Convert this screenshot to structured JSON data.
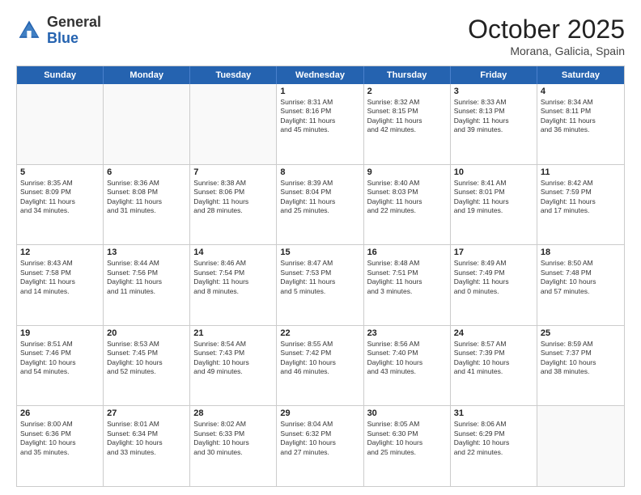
{
  "header": {
    "logo_general": "General",
    "logo_blue": "Blue",
    "month_title": "October 2025",
    "location": "Morana, Galicia, Spain"
  },
  "weekdays": [
    "Sunday",
    "Monday",
    "Tuesday",
    "Wednesday",
    "Thursday",
    "Friday",
    "Saturday"
  ],
  "rows": [
    [
      {
        "day": "",
        "text": ""
      },
      {
        "day": "",
        "text": ""
      },
      {
        "day": "",
        "text": ""
      },
      {
        "day": "1",
        "text": "Sunrise: 8:31 AM\nSunset: 8:16 PM\nDaylight: 11 hours\nand 45 minutes."
      },
      {
        "day": "2",
        "text": "Sunrise: 8:32 AM\nSunset: 8:15 PM\nDaylight: 11 hours\nand 42 minutes."
      },
      {
        "day": "3",
        "text": "Sunrise: 8:33 AM\nSunset: 8:13 PM\nDaylight: 11 hours\nand 39 minutes."
      },
      {
        "day": "4",
        "text": "Sunrise: 8:34 AM\nSunset: 8:11 PM\nDaylight: 11 hours\nand 36 minutes."
      }
    ],
    [
      {
        "day": "5",
        "text": "Sunrise: 8:35 AM\nSunset: 8:09 PM\nDaylight: 11 hours\nand 34 minutes."
      },
      {
        "day": "6",
        "text": "Sunrise: 8:36 AM\nSunset: 8:08 PM\nDaylight: 11 hours\nand 31 minutes."
      },
      {
        "day": "7",
        "text": "Sunrise: 8:38 AM\nSunset: 8:06 PM\nDaylight: 11 hours\nand 28 minutes."
      },
      {
        "day": "8",
        "text": "Sunrise: 8:39 AM\nSunset: 8:04 PM\nDaylight: 11 hours\nand 25 minutes."
      },
      {
        "day": "9",
        "text": "Sunrise: 8:40 AM\nSunset: 8:03 PM\nDaylight: 11 hours\nand 22 minutes."
      },
      {
        "day": "10",
        "text": "Sunrise: 8:41 AM\nSunset: 8:01 PM\nDaylight: 11 hours\nand 19 minutes."
      },
      {
        "day": "11",
        "text": "Sunrise: 8:42 AM\nSunset: 7:59 PM\nDaylight: 11 hours\nand 17 minutes."
      }
    ],
    [
      {
        "day": "12",
        "text": "Sunrise: 8:43 AM\nSunset: 7:58 PM\nDaylight: 11 hours\nand 14 minutes."
      },
      {
        "day": "13",
        "text": "Sunrise: 8:44 AM\nSunset: 7:56 PM\nDaylight: 11 hours\nand 11 minutes."
      },
      {
        "day": "14",
        "text": "Sunrise: 8:46 AM\nSunset: 7:54 PM\nDaylight: 11 hours\nand 8 minutes."
      },
      {
        "day": "15",
        "text": "Sunrise: 8:47 AM\nSunset: 7:53 PM\nDaylight: 11 hours\nand 5 minutes."
      },
      {
        "day": "16",
        "text": "Sunrise: 8:48 AM\nSunset: 7:51 PM\nDaylight: 11 hours\nand 3 minutes."
      },
      {
        "day": "17",
        "text": "Sunrise: 8:49 AM\nSunset: 7:49 PM\nDaylight: 11 hours\nand 0 minutes."
      },
      {
        "day": "18",
        "text": "Sunrise: 8:50 AM\nSunset: 7:48 PM\nDaylight: 10 hours\nand 57 minutes."
      }
    ],
    [
      {
        "day": "19",
        "text": "Sunrise: 8:51 AM\nSunset: 7:46 PM\nDaylight: 10 hours\nand 54 minutes."
      },
      {
        "day": "20",
        "text": "Sunrise: 8:53 AM\nSunset: 7:45 PM\nDaylight: 10 hours\nand 52 minutes."
      },
      {
        "day": "21",
        "text": "Sunrise: 8:54 AM\nSunset: 7:43 PM\nDaylight: 10 hours\nand 49 minutes."
      },
      {
        "day": "22",
        "text": "Sunrise: 8:55 AM\nSunset: 7:42 PM\nDaylight: 10 hours\nand 46 minutes."
      },
      {
        "day": "23",
        "text": "Sunrise: 8:56 AM\nSunset: 7:40 PM\nDaylight: 10 hours\nand 43 minutes."
      },
      {
        "day": "24",
        "text": "Sunrise: 8:57 AM\nSunset: 7:39 PM\nDaylight: 10 hours\nand 41 minutes."
      },
      {
        "day": "25",
        "text": "Sunrise: 8:59 AM\nSunset: 7:37 PM\nDaylight: 10 hours\nand 38 minutes."
      }
    ],
    [
      {
        "day": "26",
        "text": "Sunrise: 8:00 AM\nSunset: 6:36 PM\nDaylight: 10 hours\nand 35 minutes."
      },
      {
        "day": "27",
        "text": "Sunrise: 8:01 AM\nSunset: 6:34 PM\nDaylight: 10 hours\nand 33 minutes."
      },
      {
        "day": "28",
        "text": "Sunrise: 8:02 AM\nSunset: 6:33 PM\nDaylight: 10 hours\nand 30 minutes."
      },
      {
        "day": "29",
        "text": "Sunrise: 8:04 AM\nSunset: 6:32 PM\nDaylight: 10 hours\nand 27 minutes."
      },
      {
        "day": "30",
        "text": "Sunrise: 8:05 AM\nSunset: 6:30 PM\nDaylight: 10 hours\nand 25 minutes."
      },
      {
        "day": "31",
        "text": "Sunrise: 8:06 AM\nSunset: 6:29 PM\nDaylight: 10 hours\nand 22 minutes."
      },
      {
        "day": "",
        "text": ""
      }
    ]
  ]
}
